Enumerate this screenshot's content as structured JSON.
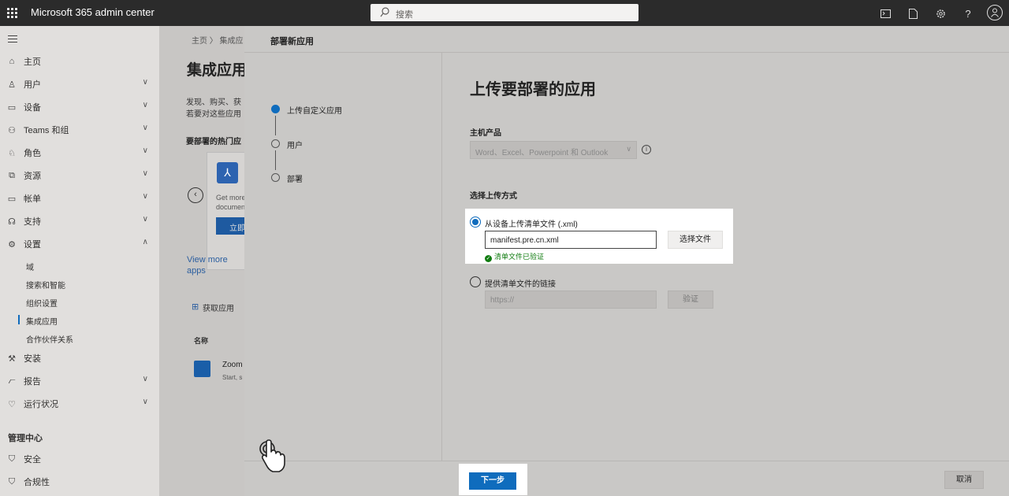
{
  "app": {
    "title": "Microsoft 365 admin center"
  },
  "search": {
    "placeholder": "搜索"
  },
  "topbar_icons": [
    "terminal-icon",
    "document-icon",
    "gear-icon",
    "help-icon",
    "user-avatar-icon"
  ],
  "help_glyph": "?",
  "nav": {
    "items": [
      {
        "label": "主页",
        "icon": "home-icon",
        "chevron": ""
      },
      {
        "label": "用户",
        "icon": "person-icon",
        "chevron": "∨"
      },
      {
        "label": "设备",
        "icon": "laptop-icon",
        "chevron": "∨"
      },
      {
        "label": "Teams 和组",
        "icon": "people-icon",
        "chevron": "∨"
      },
      {
        "label": "角色",
        "icon": "role-icon",
        "chevron": "∨"
      },
      {
        "label": "资源",
        "icon": "resource-icon",
        "chevron": "∨"
      },
      {
        "label": "帐单",
        "icon": "billing-icon",
        "chevron": "∨"
      },
      {
        "label": "支持",
        "icon": "headset-icon",
        "chevron": "∨"
      },
      {
        "label": "设置",
        "icon": "gear-icon",
        "chevron": "∧"
      }
    ],
    "settings_sub": [
      "域",
      "搜索和智能",
      "组织设置",
      "集成应用",
      "合作伙伴关系"
    ],
    "bottom_items": [
      {
        "label": "安装",
        "icon": "wrench-icon",
        "chevron": ""
      },
      {
        "label": "报告",
        "icon": "chart-icon",
        "chevron": "∨"
      },
      {
        "label": "运行状况",
        "icon": "heart-icon",
        "chevron": "∨"
      }
    ],
    "section_title": "管理中心",
    "admin_centers": [
      {
        "label": "安全",
        "icon": "shield-icon"
      },
      {
        "label": "合规性",
        "icon": "shield-icon"
      }
    ]
  },
  "background": {
    "breadcrumb": "主页  〉 集成应",
    "title": "集成应用",
    "desc1": "发现、购买、获",
    "desc2": "若要对这些应用",
    "popular": "要部署的热门应",
    "card_desc1": "Get more",
    "card_desc2": "documen",
    "card_btn": "立即",
    "view_more1": "View more",
    "view_more2": "apps",
    "get_apps": "获取应用",
    "col_name": "名称",
    "row_title": "Zoom",
    "row_sub": "Start, s"
  },
  "panel": {
    "title": "部署新应用",
    "steps": [
      "上传自定义应用",
      "用户",
      "部署"
    ],
    "heading": "上传要部署的应用",
    "host_label": "主机产品",
    "host_value": "Word、Excel、Powerpoint 和 Outlook",
    "upload_method_label": "选择上传方式",
    "option1_label": "从设备上传清单文件 (.xml)",
    "file_value": "manifest.pre.cn.xml",
    "choose_file": "选择文件",
    "validated": "清单文件已验证",
    "option2_label": "提供清单文件的链接",
    "url_placeholder": "https://",
    "verify": "验证",
    "next": "下一步",
    "cancel": "取消"
  },
  "colors": {
    "accent": "#0f6cbd",
    "success": "#107c10",
    "topbar": "#2b2b2b"
  }
}
